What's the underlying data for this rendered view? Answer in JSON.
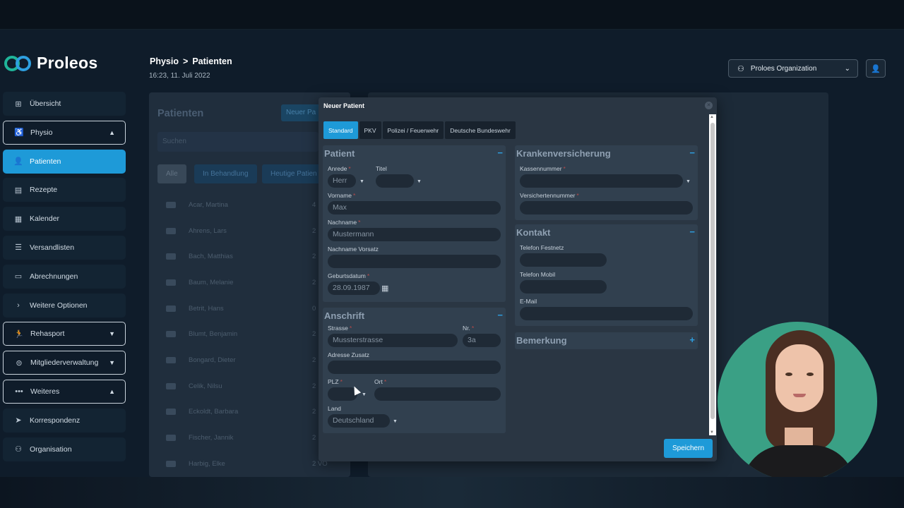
{
  "app": {
    "brand": "Proleos"
  },
  "sidebar": {
    "items": [
      {
        "label": "Übersicht",
        "icon": "grid-icon"
      },
      {
        "label": "Physio",
        "icon": "physio-icon",
        "chevron": "up"
      },
      {
        "label": "Patienten",
        "icon": "user-icon"
      },
      {
        "label": "Rezepte",
        "icon": "clipboard-icon"
      },
      {
        "label": "Kalender",
        "icon": "calendar-icon"
      },
      {
        "label": "Versandlisten",
        "icon": "list-icon"
      },
      {
        "label": "Abrechnungen",
        "icon": "invoice-icon"
      },
      {
        "label": "Weitere Optionen",
        "icon": "chevron-right-icon"
      },
      {
        "label": "Rehasport",
        "icon": "run-icon",
        "chevron": "down"
      },
      {
        "label": "Mitgliederverwaltung",
        "icon": "member-icon",
        "chevron": "down"
      },
      {
        "label": "Weiteres",
        "icon": "more-icon",
        "chevron": "up"
      },
      {
        "label": "Korrespondenz",
        "icon": "send-icon"
      },
      {
        "label": "Organisation",
        "icon": "org-icon"
      }
    ]
  },
  "header": {
    "breadcrumb": [
      "Physio",
      "Patienten"
    ],
    "separator": ">",
    "datetime": "16:23, 11. Juli 2022",
    "org_select": "Proloes Organization"
  },
  "patients_panel": {
    "title": "Patienten",
    "new_button": "Neuer Pa",
    "search_placeholder": "Suchen",
    "filters": [
      "Alle",
      "In Behandlung",
      "Heutige Patien"
    ],
    "rows": [
      {
        "name": "Acar, Martina",
        "count": "4"
      },
      {
        "name": "Ahrens, Lars",
        "count": "2"
      },
      {
        "name": "Bach, Matthias",
        "count": "2"
      },
      {
        "name": "Baum, Melanie",
        "count": "2"
      },
      {
        "name": "Betrit, Hans",
        "count": "0"
      },
      {
        "name": "Blumt, Benjamin",
        "count": "2"
      },
      {
        "name": "Bongard, Dieter",
        "count": "2"
      },
      {
        "name": "Celik, Nilsu",
        "count": "2"
      },
      {
        "name": "Eckoldt, Barbara",
        "count": "2"
      },
      {
        "name": "Fischer, Jannik",
        "count": "2"
      },
      {
        "name": "Harbig, Elke",
        "count": "2 VO"
      }
    ]
  },
  "dialog": {
    "title": "Neuer Patient",
    "tabs": [
      "Standard",
      "PKV",
      "Polizei / Feuerwehr",
      "Deutsche Bundeswehr"
    ],
    "patient": {
      "title": "Patient",
      "toggle": "−",
      "anrede_label": "Anrede",
      "anrede_value": "Herr",
      "titel_label": "Titel",
      "vorname_label": "Vorname",
      "vorname_value": "Max",
      "nachname_label": "Nachname",
      "nachname_value": "Mustermann",
      "vorsatz_label": "Nachname Vorsatz",
      "geburtsdatum_label": "Geburtsdatum",
      "geburtsdatum_value": "28.09.1987"
    },
    "anschrift": {
      "title": "Anschrift",
      "toggle": "−",
      "strasse_label": "Strasse",
      "strasse_value": "Mussterstrasse",
      "nr_label": "Nr.",
      "nr_value": "3a",
      "zusatz_label": "Adresse Zusatz",
      "plz_label": "PLZ",
      "ort_label": "Ort",
      "land_label": "Land",
      "land_value": "Deutschland"
    },
    "kv": {
      "title": "Krankenversicherung",
      "toggle": "−",
      "kassennummer_label": "Kassennummer",
      "versichertennummer_label": "Versichertennummer"
    },
    "kontakt": {
      "title": "Kontakt",
      "toggle": "−",
      "festnetz_label": "Telefon Festnetz",
      "mobil_label": "Telefon Mobil",
      "email_label": "E-Mail"
    },
    "bemerkung": {
      "title": "Bemerkung",
      "toggle": "+"
    },
    "save_label": "Speichern"
  },
  "colors": {
    "accent": "#1e9ad8",
    "required": "#b74a4a",
    "presenter_bg": "#3aa085"
  }
}
